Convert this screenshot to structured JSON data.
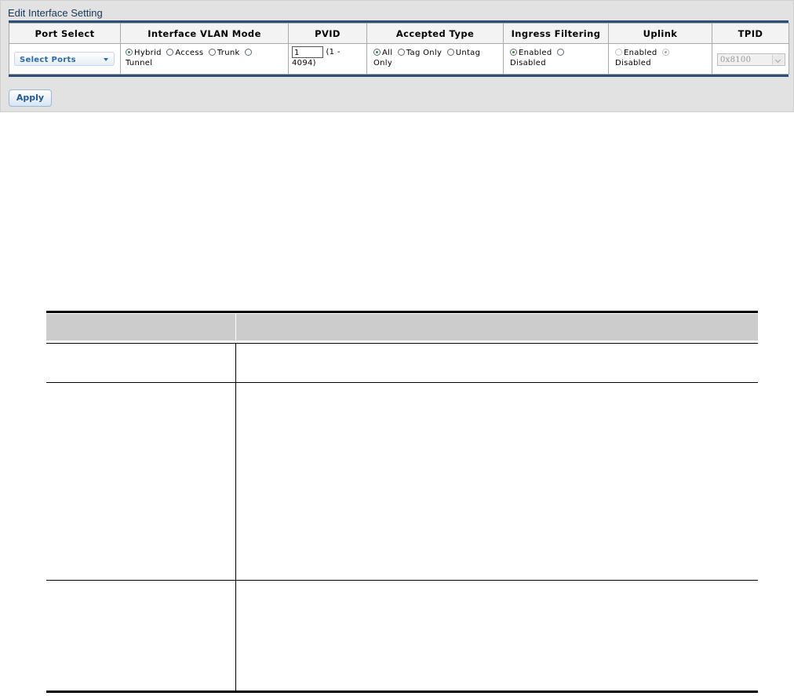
{
  "panel": {
    "title": "Edit Interface Setting",
    "columns": [
      "Port Select",
      "Interface VLAN Mode",
      "PVID",
      "Accepted Type",
      "Ingress Filtering",
      "Uplink",
      "TPID"
    ],
    "port_select": {
      "label": "Select Ports"
    },
    "vlan_mode": {
      "options": [
        "Hybrid",
        "Access",
        "Trunk",
        "Tunnel"
      ],
      "selected": "Hybrid"
    },
    "pvid": {
      "value": "1",
      "range_a": "(1 -",
      "range_b": "4094)"
    },
    "accepted_type": {
      "options": [
        "All",
        "Tag Only",
        "Untag",
        "Only"
      ],
      "selected": "All"
    },
    "ingress_filtering": {
      "options": [
        "Enabled",
        "Disabled"
      ],
      "selected": "Enabled"
    },
    "uplink": {
      "options": [
        "Enabled",
        "Disabled"
      ],
      "selected": "Disabled",
      "disabled": true
    },
    "tpid": {
      "value": "0x8100",
      "disabled": true
    },
    "apply_label": "Apply"
  },
  "colors": {
    "accent": "#2a4f7a",
    "title": "#16365c",
    "panel_bg": "#e2e2e2",
    "radio_on": "#2f8b3a"
  }
}
